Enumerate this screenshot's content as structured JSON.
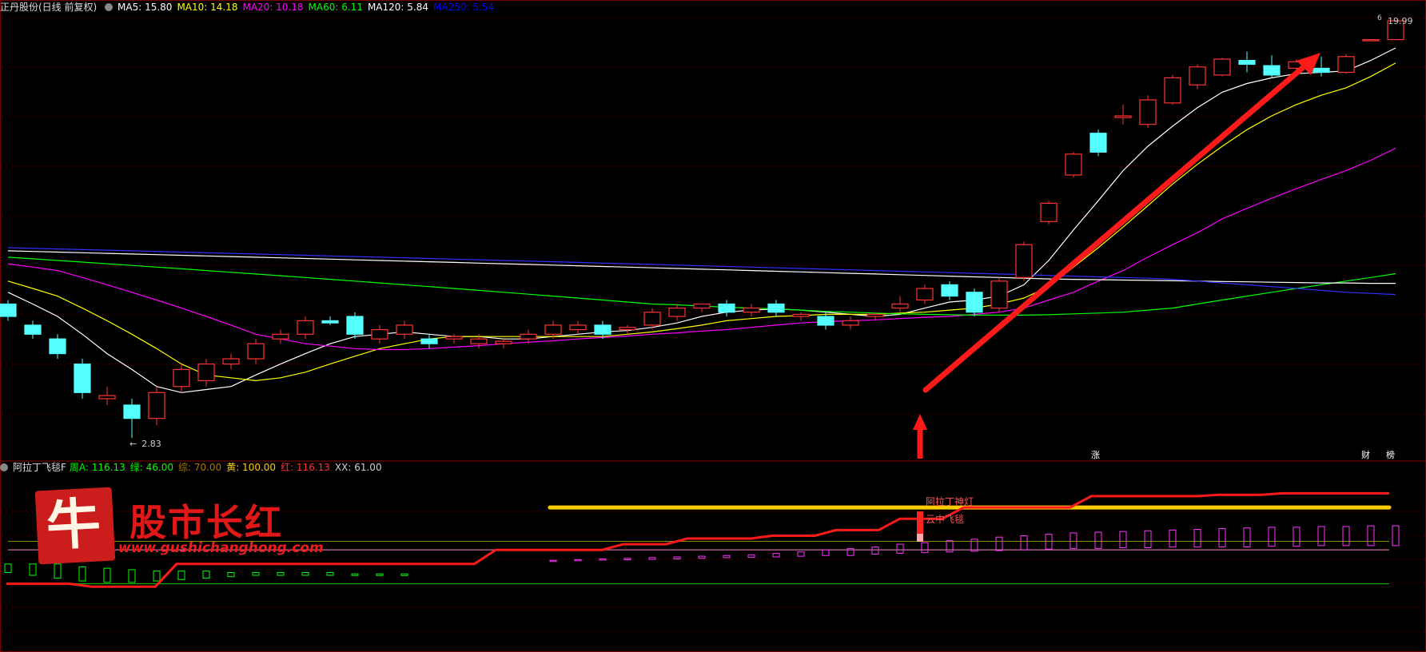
{
  "header": {
    "title": "正丹股份(日线 前复权)",
    "ma": [
      {
        "label": "MA5: 15.80",
        "color": "#ffffff"
      },
      {
        "label": "MA10: 14.18",
        "color": "#ffff00"
      },
      {
        "label": "MA20: 10.18",
        "color": "#ff00ff"
      },
      {
        "label": "MA60: 6.11",
        "color": "#00ff00"
      },
      {
        "label": "MA120: 5.84",
        "color": "#ffffff"
      },
      {
        "label": "MA250: 5.54",
        "color": "#0000ff"
      }
    ]
  },
  "indicator_header": {
    "title": "阿拉丁飞毯F",
    "items": [
      {
        "label": "周A: 116.13",
        "color": "#00ff00"
      },
      {
        "label": "绿: 46.00",
        "color": "#00ff00"
      },
      {
        "label": "综: 70.00",
        "color": "#aa7700"
      },
      {
        "label": "黄: 100.00",
        "color": "#ffcc00"
      },
      {
        "label": "红: 116.13",
        "color": "#ff3333"
      },
      {
        "label": "XX: 61.00",
        "color": "#cccccc"
      }
    ]
  },
  "price_labels": {
    "high": "19.99",
    "low": "2.83",
    "high_mark": "6"
  },
  "badges": [
    {
      "text": "涨",
      "color": "#c81e1e"
    },
    {
      "text": "财",
      "color": "#3a5fd0"
    },
    {
      "text": "榜",
      "color": "#c87820"
    }
  ],
  "annotations": {
    "signal1": "阿拉丁神灯",
    "signal2": "云中飞毯"
  },
  "brand": {
    "logo_char": "牛",
    "title": "股市长红",
    "url": "www.gushichanghong.com"
  },
  "colors": {
    "up": "#ff3333",
    "down": "#54ffff",
    "bg": "#000000",
    "grid": "#5a0000"
  },
  "chart_data": [
    {
      "type": "candlestick",
      "title": "正丹股份(日线 前复权)",
      "note": "daily candles, qfq-adjusted; oldest first; o/h/l/c in price units",
      "candles": [
        {
          "o": 5.3,
          "c": 5.0,
          "h": 5.4,
          "l": 4.9
        },
        {
          "o": 4.8,
          "c": 4.6,
          "h": 4.9,
          "l": 4.5
        },
        {
          "o": 4.5,
          "c": 4.2,
          "h": 4.6,
          "l": 4.1
        },
        {
          "o": 4.0,
          "c": 3.5,
          "h": 4.1,
          "l": 3.4
        },
        {
          "o": 3.4,
          "c": 3.45,
          "h": 3.6,
          "l": 3.3
        },
        {
          "o": 3.3,
          "c": 3.1,
          "h": 3.4,
          "l": 2.83
        },
        {
          "o": 3.1,
          "c": 3.5,
          "h": 3.6,
          "l": 3.0
        },
        {
          "o": 3.6,
          "c": 3.9,
          "h": 4.0,
          "l": 3.5
        },
        {
          "o": 3.7,
          "c": 4.0,
          "h": 4.1,
          "l": 3.6
        },
        {
          "o": 4.0,
          "c": 4.1,
          "h": 4.2,
          "l": 3.9
        },
        {
          "o": 4.1,
          "c": 4.4,
          "h": 4.5,
          "l": 4.0
        },
        {
          "o": 4.5,
          "c": 4.6,
          "h": 4.7,
          "l": 4.4
        },
        {
          "o": 4.6,
          "c": 4.9,
          "h": 5.0,
          "l": 4.5
        },
        {
          "o": 4.9,
          "c": 4.85,
          "h": 5.0,
          "l": 4.8
        },
        {
          "o": 5.0,
          "c": 4.6,
          "h": 5.1,
          "l": 4.5
        },
        {
          "o": 4.5,
          "c": 4.7,
          "h": 4.8,
          "l": 4.4
        },
        {
          "o": 4.6,
          "c": 4.8,
          "h": 4.9,
          "l": 4.5
        },
        {
          "o": 4.5,
          "c": 4.4,
          "h": 4.6,
          "l": 4.3
        },
        {
          "o": 4.5,
          "c": 4.55,
          "h": 4.6,
          "l": 4.4
        },
        {
          "o": 4.4,
          "c": 4.5,
          "h": 4.6,
          "l": 4.3
        },
        {
          "o": 4.4,
          "c": 4.45,
          "h": 4.5,
          "l": 4.3
        },
        {
          "o": 4.5,
          "c": 4.6,
          "h": 4.7,
          "l": 4.4
        },
        {
          "o": 4.6,
          "c": 4.8,
          "h": 4.9,
          "l": 4.5
        },
        {
          "o": 4.7,
          "c": 4.8,
          "h": 4.9,
          "l": 4.6
        },
        {
          "o": 4.8,
          "c": 4.6,
          "h": 4.9,
          "l": 4.5
        },
        {
          "o": 4.7,
          "c": 4.75,
          "h": 4.8,
          "l": 4.6
        },
        {
          "o": 4.8,
          "c": 5.1,
          "h": 5.2,
          "l": 4.7
        },
        {
          "o": 5.0,
          "c": 5.2,
          "h": 5.3,
          "l": 4.9
        },
        {
          "o": 5.2,
          "c": 5.3,
          "h": 5.3,
          "l": 5.1
        },
        {
          "o": 5.3,
          "c": 5.1,
          "h": 5.4,
          "l": 5.0
        },
        {
          "o": 5.1,
          "c": 5.2,
          "h": 5.3,
          "l": 5.0
        },
        {
          "o": 5.3,
          "c": 5.1,
          "h": 5.4,
          "l": 5.0
        },
        {
          "o": 5.0,
          "c": 5.05,
          "h": 5.1,
          "l": 4.9
        },
        {
          "o": 5.0,
          "c": 4.8,
          "h": 5.1,
          "l": 4.7
        },
        {
          "o": 4.8,
          "c": 4.9,
          "h": 5.0,
          "l": 4.7
        },
        {
          "o": 5.0,
          "c": 5.05,
          "h": 5.1,
          "l": 4.9
        },
        {
          "o": 5.2,
          "c": 5.3,
          "h": 5.5,
          "l": 5.1
        },
        {
          "o": 5.4,
          "c": 5.7,
          "h": 5.8,
          "l": 5.3
        },
        {
          "o": 5.8,
          "c": 5.5,
          "h": 5.9,
          "l": 5.4
        },
        {
          "o": 5.6,
          "c": 5.1,
          "h": 5.7,
          "l": 5.0
        },
        {
          "o": 5.2,
          "c": 5.9,
          "h": 6.0,
          "l": 5.1
        },
        {
          "o": 6.0,
          "c": 7.0,
          "h": 7.1,
          "l": 5.9
        },
        {
          "o": 7.8,
          "c": 8.5,
          "h": 8.6,
          "l": 7.7
        },
        {
          "o": 9.7,
          "c": 10.7,
          "h": 10.8,
          "l": 9.6
        },
        {
          "o": 11.8,
          "c": 10.8,
          "h": 12.0,
          "l": 10.6
        },
        {
          "o": 12.7,
          "c": 12.8,
          "h": 13.5,
          "l": 12.3
        },
        {
          "o": 12.3,
          "c": 13.8,
          "h": 14.1,
          "l": 12.1
        },
        {
          "o": 13.6,
          "c": 15.3,
          "h": 15.5,
          "l": 13.5
        },
        {
          "o": 14.8,
          "c": 16.1,
          "h": 16.3,
          "l": 14.5
        },
        {
          "o": 15.5,
          "c": 16.7,
          "h": 16.8,
          "l": 15.4
        },
        {
          "o": 16.6,
          "c": 16.3,
          "h": 17.3,
          "l": 15.7
        },
        {
          "o": 16.2,
          "c": 15.5,
          "h": 17.0,
          "l": 15.3
        },
        {
          "o": 16.0,
          "c": 16.5,
          "h": 16.7,
          "l": 15.5
        },
        {
          "o": 16.0,
          "c": 15.7,
          "h": 16.9,
          "l": 15.4
        },
        {
          "o": 15.7,
          "c": 16.9,
          "h": 17.1,
          "l": 15.6
        },
        {
          "o": 18.3,
          "c": 18.3,
          "h": 18.3,
          "l": 18.3
        },
        {
          "o": 18.3,
          "c": 19.99,
          "h": 19.99,
          "l": 18.3
        }
      ],
      "ma": [
        {
          "name": "MA5",
          "color": "#ffffff",
          "values": [
            5.6,
            5.3,
            5.0,
            4.6,
            4.2,
            3.9,
            3.6,
            3.5,
            3.55,
            3.6,
            3.8,
            4.0,
            4.2,
            4.4,
            4.55,
            4.6,
            4.65,
            4.6,
            4.55,
            4.55,
            4.5,
            4.5,
            4.55,
            4.6,
            4.65,
            4.68,
            4.75,
            4.85,
            5.0,
            5.1,
            5.15,
            5.18,
            5.15,
            5.1,
            5.05,
            5.0,
            5.05,
            5.2,
            5.35,
            5.4,
            5.5,
            5.8,
            6.5,
            7.5,
            8.6,
            9.9,
            11.1,
            12.2,
            13.3,
            14.3,
            14.9,
            15.3,
            15.6,
            15.7,
            15.8,
            16.6,
            17.6
          ]
        },
        {
          "name": "MA10",
          "color": "#ffff00",
          "values": [
            5.9,
            5.7,
            5.5,
            5.2,
            4.9,
            4.6,
            4.3,
            4.0,
            3.8,
            3.75,
            3.7,
            3.75,
            3.85,
            4.0,
            4.15,
            4.3,
            4.4,
            4.5,
            4.55,
            4.55,
            4.55,
            4.55,
            4.55,
            4.55,
            4.55,
            4.6,
            4.65,
            4.72,
            4.8,
            4.9,
            4.95,
            5.0,
            5.02,
            5.05,
            5.05,
            5.05,
            5.08,
            5.1,
            5.15,
            5.2,
            5.3,
            5.45,
            5.75,
            6.3,
            6.9,
            7.6,
            8.4,
            9.3,
            10.2,
            11.1,
            12.0,
            12.8,
            13.5,
            14.1,
            14.6,
            15.4,
            16.4
          ]
        },
        {
          "name": "MA20",
          "color": "#ff00ff",
          "values": [
            6.4,
            6.3,
            6.2,
            6.0,
            5.8,
            5.6,
            5.4,
            5.2,
            5.0,
            4.8,
            4.6,
            4.5,
            4.4,
            4.35,
            4.3,
            4.28,
            4.28,
            4.3,
            4.33,
            4.36,
            4.4,
            4.43,
            4.46,
            4.5,
            4.53,
            4.56,
            4.6,
            4.63,
            4.67,
            4.7,
            4.75,
            4.8,
            4.85,
            4.88,
            4.9,
            4.92,
            4.95,
            4.98,
            5.0,
            5.05,
            5.1,
            5.2,
            5.4,
            5.6,
            5.9,
            6.2,
            6.6,
            7.0,
            7.4,
            7.9,
            8.3,
            8.7,
            9.1,
            9.5,
            9.9,
            10.4,
            11.0
          ]
        },
        {
          "name": "MA60",
          "color": "#00ff00",
          "values": [
            6.6,
            6.55,
            6.5,
            6.45,
            6.4,
            6.35,
            6.3,
            6.25,
            6.2,
            6.15,
            6.1,
            6.05,
            6.0,
            5.95,
            5.9,
            5.85,
            5.8,
            5.75,
            5.7,
            5.65,
            5.6,
            5.55,
            5.5,
            5.45,
            5.4,
            5.35,
            5.3,
            5.28,
            5.25,
            5.22,
            5.2,
            5.18,
            5.15,
            5.12,
            5.1,
            5.08,
            5.06,
            5.05,
            5.04,
            5.03,
            5.03,
            5.03,
            5.04,
            5.06,
            5.08,
            5.1,
            5.15,
            5.2,
            5.3,
            5.4,
            5.5,
            5.6,
            5.7,
            5.8,
            5.9,
            6.0,
            6.11
          ]
        },
        {
          "name": "MA120",
          "color": "#ffffff",
          "values": [
            6.8,
            6.78,
            6.76,
            6.74,
            6.72,
            6.7,
            6.68,
            6.66,
            6.64,
            6.62,
            6.6,
            6.58,
            6.56,
            6.54,
            6.52,
            6.5,
            6.48,
            6.46,
            6.44,
            6.42,
            6.4,
            6.38,
            6.36,
            6.34,
            6.32,
            6.3,
            6.28,
            6.26,
            6.24,
            6.22,
            6.2,
            6.18,
            6.16,
            6.14,
            6.12,
            6.1,
            6.08,
            6.06,
            6.04,
            6.02,
            6.0,
            5.98,
            5.96,
            5.95,
            5.94,
            5.93,
            5.92,
            5.91,
            5.9,
            5.89,
            5.88,
            5.87,
            5.86,
            5.85,
            5.85,
            5.84,
            5.84
          ]
        },
        {
          "name": "MA250",
          "color": "#3030ff",
          "values": [
            6.9,
            6.88,
            6.86,
            6.84,
            6.82,
            6.8,
            6.78,
            6.76,
            6.74,
            6.72,
            6.7,
            6.68,
            6.66,
            6.64,
            6.62,
            6.6,
            6.58,
            6.56,
            6.54,
            6.52,
            6.5,
            6.48,
            6.46,
            6.44,
            6.42,
            6.4,
            6.38,
            6.36,
            6.34,
            6.32,
            6.3,
            6.28,
            6.26,
            6.24,
            6.22,
            6.2,
            6.18,
            6.16,
            6.14,
            6.12,
            6.1,
            6.08,
            6.06,
            6.04,
            6.02,
            6.0,
            5.98,
            5.95,
            5.9,
            5.85,
            5.8,
            5.75,
            5.7,
            5.65,
            5.6,
            5.57,
            5.54
          ]
        }
      ]
    },
    {
      "type": "indicator",
      "title": "阿拉丁飞毯F",
      "note": "sub-panel; levels in indicator units, one value per bar",
      "ylim": [
        0,
        130
      ],
      "levels": {
        "yellow": 100.0,
        "olive": 76.0,
        "pink": 70.0,
        "green": 46.0
      },
      "red_line": [
        46,
        46,
        46,
        46,
        44,
        44,
        44,
        44,
        60,
        60,
        60,
        60,
        60,
        60,
        60,
        60,
        60,
        60,
        60,
        60,
        60,
        60,
        60,
        70,
        70,
        70,
        70,
        70,
        70,
        74,
        74,
        74,
        78,
        78,
        78,
        78,
        80,
        80,
        80,
        84,
        84,
        84,
        92,
        92,
        92,
        100,
        100,
        100,
        100,
        100,
        100,
        108,
        108,
        108,
        108,
        108,
        108,
        109,
        109,
        109,
        110,
        110,
        110,
        110,
        110,
        110
      ],
      "green_bars": [
        {
          "i": 0,
          "lo": 54,
          "hi": 60
        },
        {
          "i": 1,
          "lo": 52,
          "hi": 60
        },
        {
          "i": 2,
          "lo": 50,
          "hi": 60
        },
        {
          "i": 3,
          "lo": 48,
          "hi": 58
        },
        {
          "i": 4,
          "lo": 47,
          "hi": 57
        },
        {
          "i": 5,
          "lo": 47,
          "hi": 56
        },
        {
          "i": 6,
          "lo": 48,
          "hi": 55
        },
        {
          "i": 7,
          "lo": 49,
          "hi": 55
        },
        {
          "i": 8,
          "lo": 50,
          "hi": 55
        },
        {
          "i": 9,
          "lo": 51,
          "hi": 54
        },
        {
          "i": 10,
          "lo": 52,
          "hi": 54
        },
        {
          "i": 11,
          "lo": 52,
          "hi": 54
        },
        {
          "i": 12,
          "lo": 52,
          "hi": 54
        },
        {
          "i": 13,
          "lo": 52,
          "hi": 54
        },
        {
          "i": 14,
          "lo": 52,
          "hi": 53
        },
        {
          "i": 15,
          "lo": 52,
          "hi": 53
        },
        {
          "i": 16,
          "lo": 52,
          "hi": 53
        }
      ],
      "magenta_bars": [
        {
          "i": 22,
          "lo": 62,
          "hi": 62.6
        },
        {
          "i": 23,
          "lo": 62.5,
          "hi": 63.1
        },
        {
          "i": 24,
          "lo": 63,
          "hi": 63.6
        },
        {
          "i": 25,
          "lo": 63,
          "hi": 64
        },
        {
          "i": 26,
          "lo": 63.3,
          "hi": 64.5
        },
        {
          "i": 27,
          "lo": 63.6,
          "hi": 65
        },
        {
          "i": 28,
          "lo": 64,
          "hi": 65.5
        },
        {
          "i": 29,
          "lo": 64.5,
          "hi": 66
        },
        {
          "i": 30,
          "lo": 64.8,
          "hi": 66.5
        },
        {
          "i": 31,
          "lo": 65,
          "hi": 67.5
        },
        {
          "i": 32,
          "lo": 65.5,
          "hi": 68.5
        },
        {
          "i": 33,
          "lo": 66,
          "hi": 70
        },
        {
          "i": 34,
          "lo": 66,
          "hi": 71
        },
        {
          "i": 35,
          "lo": 67,
          "hi": 72
        },
        {
          "i": 36,
          "lo": 67.5,
          "hi": 74
        },
        {
          "i": 37,
          "lo": 68,
          "hi": 75
        },
        {
          "i": 38,
          "lo": 68.5,
          "hi": 76.5
        },
        {
          "i": 39,
          "lo": 69,
          "hi": 77.5
        },
        {
          "i": 40,
          "lo": 69.5,
          "hi": 79
        },
        {
          "i": 41,
          "lo": 70,
          "hi": 80
        },
        {
          "i": 42,
          "lo": 70.5,
          "hi": 81
        },
        {
          "i": 43,
          "lo": 71,
          "hi": 82
        },
        {
          "i": 44,
          "lo": 71,
          "hi": 82.5
        },
        {
          "i": 45,
          "lo": 71.5,
          "hi": 83
        },
        {
          "i": 46,
          "lo": 71.5,
          "hi": 83.5
        },
        {
          "i": 47,
          "lo": 72,
          "hi": 84
        },
        {
          "i": 48,
          "lo": 72,
          "hi": 84.5
        },
        {
          "i": 49,
          "lo": 72,
          "hi": 85
        },
        {
          "i": 50,
          "lo": 72,
          "hi": 85.5
        },
        {
          "i": 51,
          "lo": 72.5,
          "hi": 86
        },
        {
          "i": 52,
          "lo": 72.5,
          "hi": 86
        },
        {
          "i": 53,
          "lo": 73,
          "hi": 86.5
        },
        {
          "i": 54,
          "lo": 73,
          "hi": 86.5
        },
        {
          "i": 55,
          "lo": 73,
          "hi": 87
        },
        {
          "i": 56,
          "lo": 73,
          "hi": 87
        }
      ]
    }
  ]
}
